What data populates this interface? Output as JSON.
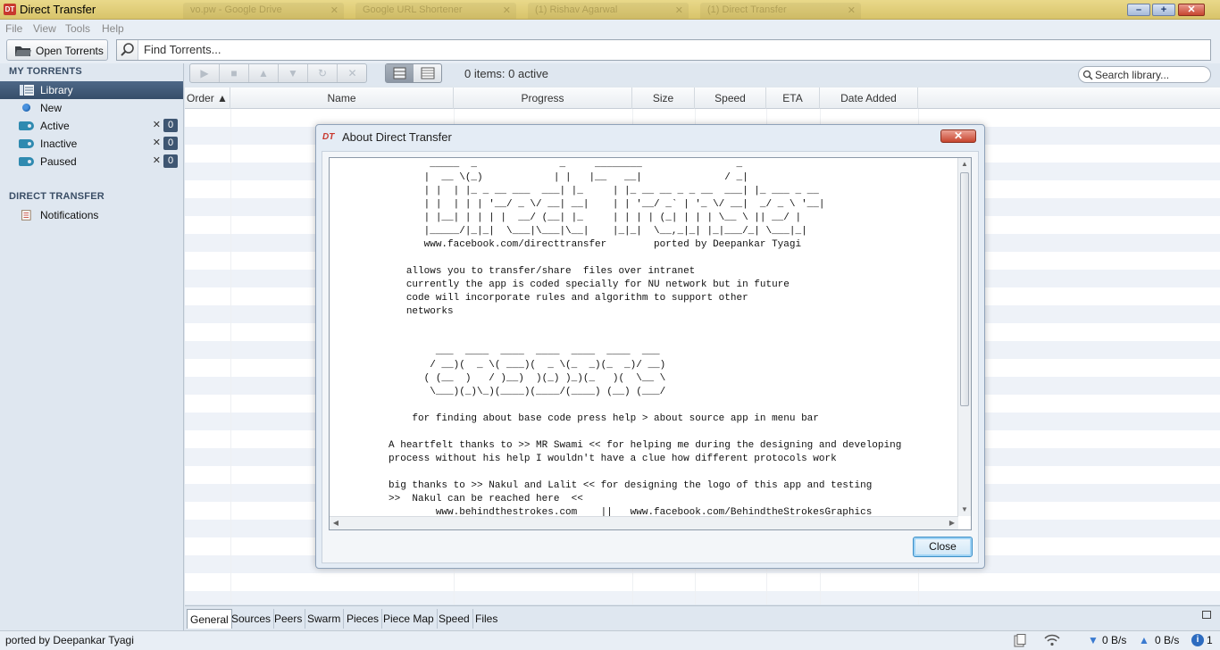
{
  "window": {
    "title": "Direct Transfer",
    "app_logo": "DT",
    "background_tabs": [
      "vo.pw - Google Drive",
      "Google URL Shortener",
      "(1) Rishav Agarwal",
      "(1) Direct Transfer"
    ],
    "minimize_label": "–",
    "maximize_label": "+",
    "close_label": "✕"
  },
  "menu": [
    "File",
    "View",
    "Tools",
    "Help"
  ],
  "toprow": {
    "open_label": "Open Torrents",
    "find_placeholder": "Find Torrents..."
  },
  "sidebar": {
    "my_torrents_heading": "MY TORRENTS",
    "items": [
      {
        "label": "Library",
        "icon": "library-icon"
      },
      {
        "label": "New",
        "icon": "new-dot-icon"
      },
      {
        "label": "Active",
        "icon": "tag-icon",
        "count": "0"
      },
      {
        "label": "Inactive",
        "icon": "tag-icon",
        "count": "0"
      },
      {
        "label": "Paused",
        "icon": "tag-icon",
        "count": "0"
      }
    ],
    "remove_glyph": "✕",
    "direct_transfer_heading": "DIRECT TRANSFER",
    "notifications_label": "Notifications"
  },
  "toolbar": {
    "status": "0 items: 0 active",
    "search_placeholder": "Search library..."
  },
  "table": {
    "columns": [
      "Order ▲",
      "Name",
      "Progress",
      "Size",
      "Speed",
      "ETA",
      "Date Added"
    ]
  },
  "bottom_tabs": [
    "General",
    "Sources",
    "Peers",
    "Swarm",
    "Pieces",
    "Piece Map",
    "Speed",
    "Files"
  ],
  "statusbar": {
    "text": "ported by Deepankar Tyagi",
    "down_rate": "0 B/s",
    "up_rate": "0 B/s",
    "info_count": "1"
  },
  "dialog": {
    "logo": "DT",
    "title": "About Direct Transfer",
    "close_x": "✕",
    "close_button": "Close",
    "content": "                 _____  _              _     ________                _\n                |  __ \\(_)            | |   |__   __|              / _|\n                | |  | |_ _ __ ___  ___| |_     | |_ __ __ _ _ __  ___| |_ ___ _ __\n                | |  | | | '__/ _ \\/ __| __|    | | '__/ _` | '_ \\/ __|  _/ _ \\ '__|\n                | |__| | | | |  __/ (__| |_     | | | | (_| | | | \\__ \\ || __/ |\n                |_____/|_|_|  \\___|\\___|\\__|    |_|_|  \\__,_|_| |_|___/_| \\___|_|\n                www.facebook.com/directtransfer        ported by Deepankar Tyagi\n\n             allows you to transfer/share  files over intranet\n             currently the app is coded specially for NU network but in future\n             code will incorporate rules and algorithm to support other\n             networks\n\n\n                  ___  ____  ____  ____  ____  ____  ___\n                 / __)(  _ \\( ___)(  _ \\(_  _)(_  _)/ __)\n                ( (__  )   / )__)  )(_) )_)(_   )(  \\__ \\\n                 \\___)(_)\\_)(____)(____/(____) (__) (___/\n\n              for finding about base code press help > about source app in menu bar\n\n          A heartfelt thanks to >> MR Swami << for helping me during the designing and developing\n          process without his help I wouldn't have a clue how different protocols work\n\n          big thanks to >> Nakul and Lalit << for designing the logo of this app and testing\n          >>  Nakul can be reached here  <<\n                  www.behindthestrokes.com    ||   www.facebook.com/BehindtheStrokesGraphics"
  },
  "colors": {
    "titlebar": "#e0cf7c",
    "sidebar_selected": "#4e6887",
    "accent_blue": "#2f8ab0",
    "row_stripe": "#eef2f8"
  }
}
